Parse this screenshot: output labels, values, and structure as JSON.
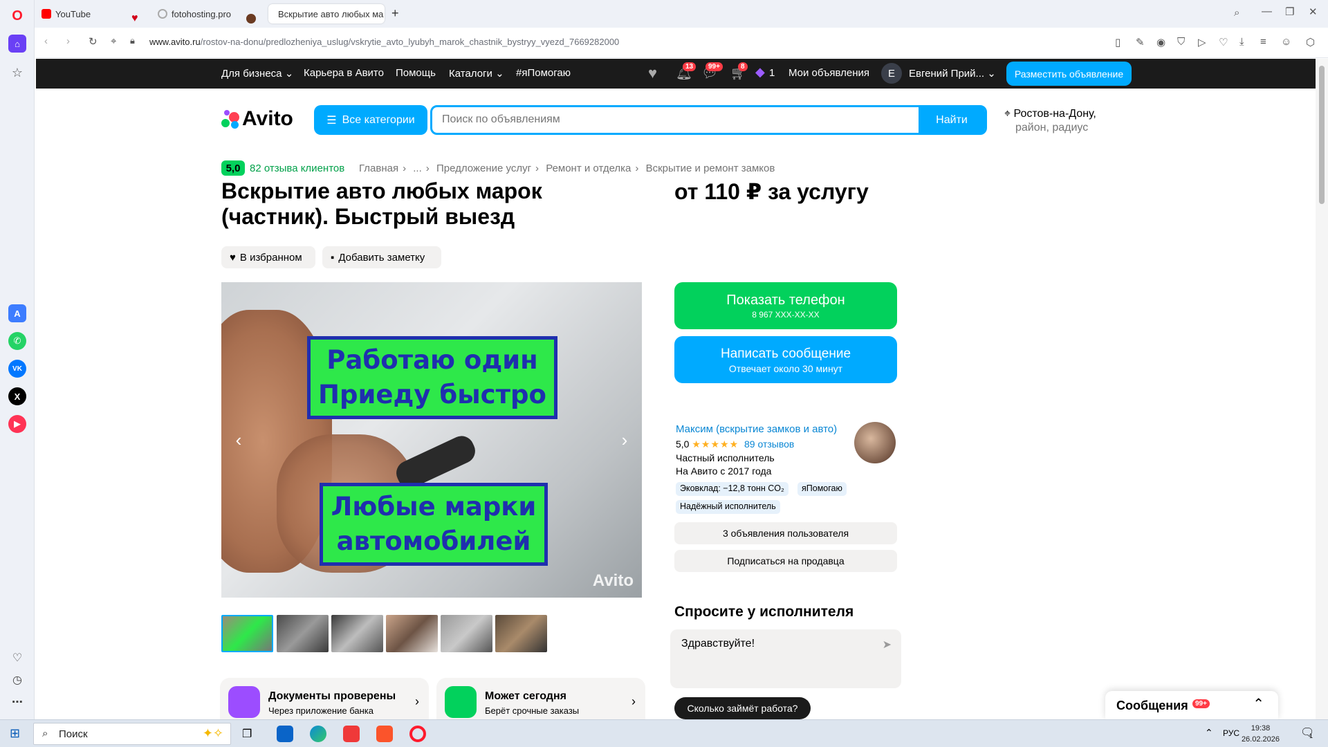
{
  "browser": {
    "tabs": [
      {
        "label": "YouTube",
        "active": false
      },
      {
        "label": "fotohosting.pro",
        "active": false
      },
      {
        "label": "Вскрытие авто любых ма",
        "active": true
      }
    ],
    "url_domain": "www.avito.ru",
    "url_path": "/rostov-na-donu/predlozheniya_uslug/vskrytie_avto_lyubyh_marok_chastnik_bystryy_vyezd_7669282000"
  },
  "topnav": {
    "business": "Для бизнеса",
    "career": "Карьера в Авито",
    "help": "Помощь",
    "catalogs": "Каталоги",
    "ihelp": "#яПомогаю",
    "badge_bell": "13",
    "badge_msg": "99+",
    "badge_cart": "8",
    "bonus_count": "1",
    "my_ads": "Мои объявления",
    "avatar_letter": "E",
    "user_name": "Евгений Прий...",
    "post_ad": "Разместить объявление"
  },
  "header": {
    "logo": "Avito",
    "categories": "Все категории",
    "search_placeholder": "Поиск по объявлениям",
    "search_button": "Найти",
    "location_line1": "Ростов-на-Дону,",
    "location_line2": "район, радиус"
  },
  "breadcrumbs": {
    "rating": "5,0",
    "reviews": "82 отзыва клиентов",
    "items": [
      "Главная",
      "...",
      "Предложение услуг",
      "Ремонт и отделка",
      "Вскрытие и ремонт замков"
    ],
    "sep": "›"
  },
  "listing": {
    "title": "Вскрытие авто любых марок (частник). Быстрый выезд",
    "price": "от 110 ₽ за услугу",
    "favorite": "В избранном",
    "add_note": "Добавить заметку",
    "photo_text_top_1": "Работаю один",
    "photo_text_top_2": "Приеду быстро",
    "photo_text_bottom_1": "Любые марки",
    "photo_text_bottom_2": "автомобилей",
    "watermark": "Avito"
  },
  "features": [
    {
      "title": "Документы проверены",
      "sub": "Через приложение банка"
    },
    {
      "title": "Может сегодня",
      "sub": "Берёт срочные заказы"
    }
  ],
  "contact": {
    "show_phone": "Показать телефон",
    "phone_mask": "8 967 XXX-XX-XX",
    "write": "Написать сообщение",
    "reply_time": "Отвечает около 30 минут"
  },
  "seller": {
    "name": "Максим (вскрытие замков и авто)",
    "rating": "5,0",
    "stars": "★★★★★",
    "reviews": "89 отзывов",
    "type": "Частный исполнитель",
    "since": "На Авито с 2017 года",
    "tags": [
      "Эковклад: −12,8 тонн CO₂",
      "яПомогаю",
      "Надёжный исполнитель"
    ],
    "ads_count": "3 объявления пользователя",
    "subscribe": "Подписаться на продавца"
  },
  "ask": {
    "title": "Спросите у исполнителя",
    "message": "Здравствуйте!",
    "chip": "Сколько займёт работа?"
  },
  "messages_panel": {
    "title": "Сообщения",
    "badge": "99+"
  },
  "taskbar": {
    "search": "Поиск",
    "lang": "РУС",
    "time": "19:38",
    "date": "26.02.2026",
    "notif": "1"
  },
  "colors": {
    "avito_blue": "#00aaff",
    "avito_green": "#02d15c",
    "dark": "#1b1b1b"
  }
}
